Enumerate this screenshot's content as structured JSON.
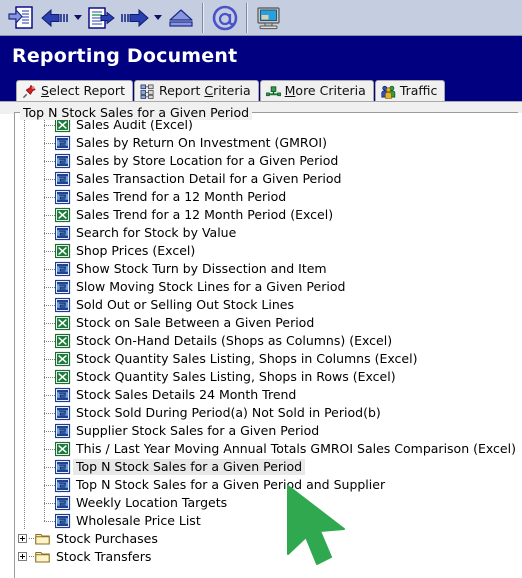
{
  "toolbar": {
    "buttons": [
      {
        "name": "new-document-icon",
        "title": "New Document"
      },
      {
        "name": "back-arrow-icon",
        "title": "Back"
      },
      {
        "name": "back-dropdown-icon",
        "title": "Back History"
      },
      {
        "name": "document-previous-icon",
        "title": "Previous Document"
      },
      {
        "name": "forward-arrow-icon",
        "title": "Forward"
      },
      {
        "name": "forward-dropdown-icon",
        "title": "Forward History"
      },
      {
        "name": "eject-icon",
        "title": "Eject"
      },
      {
        "name": "email-at-icon",
        "title": "Email"
      },
      {
        "name": "computer-monitor-icon",
        "title": "Terminal"
      }
    ]
  },
  "header": {
    "title": "Reporting Document"
  },
  "tabs": [
    {
      "label_pre": "",
      "accel": "S",
      "label_post": "elect Report",
      "icon": "pushpin-icon",
      "active": true
    },
    {
      "label_pre": "Report ",
      "accel": "C",
      "label_post": "riteria",
      "icon": "hierarchy-icon",
      "active": false
    },
    {
      "label_pre": "",
      "accel": "M",
      "label_post": "ore Criteria",
      "icon": "connector-icon",
      "active": false
    },
    {
      "label_pre": "Traffic",
      "accel": "",
      "label_post": "",
      "icon": "people-icon",
      "active": false
    }
  ],
  "groupbox": {
    "label": "Top N Stock Sales for a Given Period"
  },
  "tree": {
    "items": [
      {
        "label": "Sales Audit (Excel)",
        "icon": "excel-report-icon",
        "level": 2,
        "selected": false,
        "type": "leaf"
      },
      {
        "label": "Sales by Return On Investment (GMROI)",
        "icon": "report-icon",
        "level": 2,
        "selected": false,
        "type": "leaf"
      },
      {
        "label": "Sales by Store Location for a Given Period",
        "icon": "report-icon",
        "level": 2,
        "selected": false,
        "type": "leaf"
      },
      {
        "label": "Sales Transaction Detail for a Given Period",
        "icon": "report-icon",
        "level": 2,
        "selected": false,
        "type": "leaf"
      },
      {
        "label": "Sales Trend for a 12 Month Period",
        "icon": "report-icon",
        "level": 2,
        "selected": false,
        "type": "leaf"
      },
      {
        "label": "Sales Trend for a 12 Month Period (Excel)",
        "icon": "excel-report-icon",
        "level": 2,
        "selected": false,
        "type": "leaf"
      },
      {
        "label": "Search for Stock by Value",
        "icon": "report-icon",
        "level": 2,
        "selected": false,
        "type": "leaf"
      },
      {
        "label": "Shop Prices (Excel)",
        "icon": "excel-report-icon",
        "level": 2,
        "selected": false,
        "type": "leaf"
      },
      {
        "label": "Show Stock Turn by Dissection and Item",
        "icon": "report-icon",
        "level": 2,
        "selected": false,
        "type": "leaf"
      },
      {
        "label": "Slow Moving Stock Lines for a Given Period",
        "icon": "report-icon",
        "level": 2,
        "selected": false,
        "type": "leaf"
      },
      {
        "label": "Sold Out or Selling Out Stock Lines",
        "icon": "report-icon",
        "level": 2,
        "selected": false,
        "type": "leaf"
      },
      {
        "label": "Stock on Sale Between a Given Period",
        "icon": "excel-report-icon",
        "level": 2,
        "selected": false,
        "type": "leaf"
      },
      {
        "label": "Stock On-Hand Details (Shops as Columns) (Excel)",
        "icon": "excel-report-icon",
        "level": 2,
        "selected": false,
        "type": "leaf"
      },
      {
        "label": "Stock Quantity Sales Listing, Shops in Columns (Excel)",
        "icon": "excel-report-icon",
        "level": 2,
        "selected": false,
        "type": "leaf"
      },
      {
        "label": "Stock Quantity Sales Listing, Shops in Rows (Excel)",
        "icon": "excel-report-icon",
        "level": 2,
        "selected": false,
        "type": "leaf"
      },
      {
        "label": "Stock Sales Details 24 Month Trend",
        "icon": "report-icon",
        "level": 2,
        "selected": false,
        "type": "leaf"
      },
      {
        "label": "Stock Sold During Period(a) Not Sold in Period(b)",
        "icon": "report-icon",
        "level": 2,
        "selected": false,
        "type": "leaf"
      },
      {
        "label": "Supplier Stock Sales for a Given Period",
        "icon": "report-icon",
        "level": 2,
        "selected": false,
        "type": "leaf"
      },
      {
        "label": "This / Last Year Moving Annual Totals GMROI Sales Comparison (Excel)",
        "icon": "excel-report-icon",
        "level": 2,
        "selected": false,
        "type": "leaf"
      },
      {
        "label": "Top N Stock Sales for a Given Period",
        "icon": "report-icon",
        "level": 2,
        "selected": true,
        "type": "leaf"
      },
      {
        "label": "Top N Stock Sales for a Given Period and Supplier",
        "icon": "report-icon",
        "level": 2,
        "selected": false,
        "type": "leaf"
      },
      {
        "label": "Weekly Location Targets",
        "icon": "report-icon",
        "level": 2,
        "selected": false,
        "type": "leaf"
      },
      {
        "label": "Wholesale Price List",
        "icon": "report-icon",
        "level": 2,
        "selected": false,
        "type": "leaf",
        "last": true
      },
      {
        "label": "Stock Purchases",
        "icon": "folder-icon",
        "level": 1,
        "selected": false,
        "type": "folder"
      },
      {
        "label": "Stock Transfers",
        "icon": "folder-icon",
        "level": 1,
        "selected": false,
        "type": "folder"
      }
    ]
  },
  "cursor": {
    "name": "mouse-pointer",
    "color": "#2fa84f"
  },
  "colors": {
    "header_bg": "#000080",
    "toolbar_bg": "#c5cee0",
    "client_bg": "#f0f0f0",
    "tree_bg": "#ffffff",
    "selection_bg": "#e8e8e8",
    "excel_green": "#1f7a3d",
    "report_blue": "#3060c0"
  }
}
